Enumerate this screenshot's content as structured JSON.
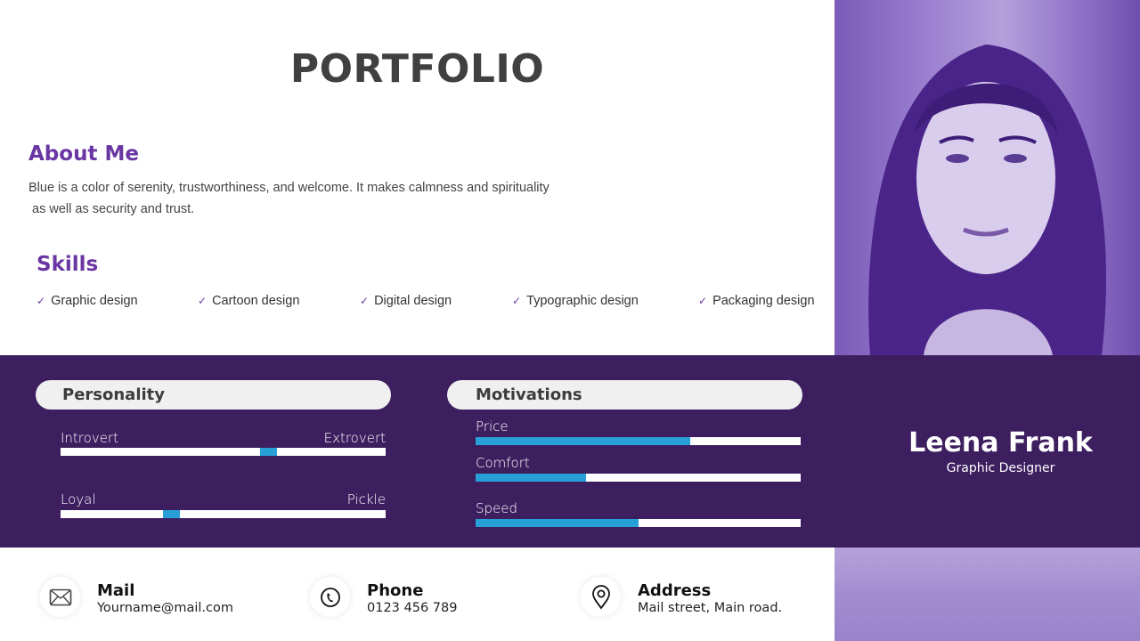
{
  "header": {
    "title": "PORTFOLIO"
  },
  "about": {
    "heading": "About Me",
    "text_line1": "Blue is a color of serenity, trustworthiness, and welcome.  It makes calmness and spirituality",
    "text_line2": " as well as security and trust."
  },
  "skills": {
    "heading": "Skills",
    "check_glyph": "✓",
    "items": [
      {
        "label": "Graphic design"
      },
      {
        "label": "Cartoon design"
      },
      {
        "label": "Digital design"
      },
      {
        "label": "Typographic design"
      },
      {
        "label": "Packaging design"
      }
    ]
  },
  "personality": {
    "heading": "Personality",
    "scales": [
      {
        "left": "Introvert",
        "right": "Extrovert",
        "value": 0.64
      },
      {
        "left": "Loyal",
        "right": "Pickle",
        "value": 0.34
      }
    ]
  },
  "motivations": {
    "heading": "Motivations",
    "bars": [
      {
        "label": "Price",
        "value": 0.66
      },
      {
        "label": "Comfort",
        "value": 0.34
      },
      {
        "label": "Speed",
        "value": 0.5
      }
    ]
  },
  "profile": {
    "name": "Leena Frank",
    "role": "Graphic Designer",
    "photo": "portrait-photo"
  },
  "contacts": [
    {
      "icon": "mail-icon",
      "title": "Mail",
      "value": "Yourname@mail.com"
    },
    {
      "icon": "phone-icon",
      "title": "Phone",
      "value": "0123 456 789"
    },
    {
      "icon": "location-pin-icon",
      "title": "Address",
      "value": "Mail street, Main road."
    }
  ],
  "colors": {
    "accent_purple": "#6a36a3",
    "band_purple": "#3d1f60",
    "bar_blue": "#27a0d8",
    "title_gray": "#404040"
  }
}
